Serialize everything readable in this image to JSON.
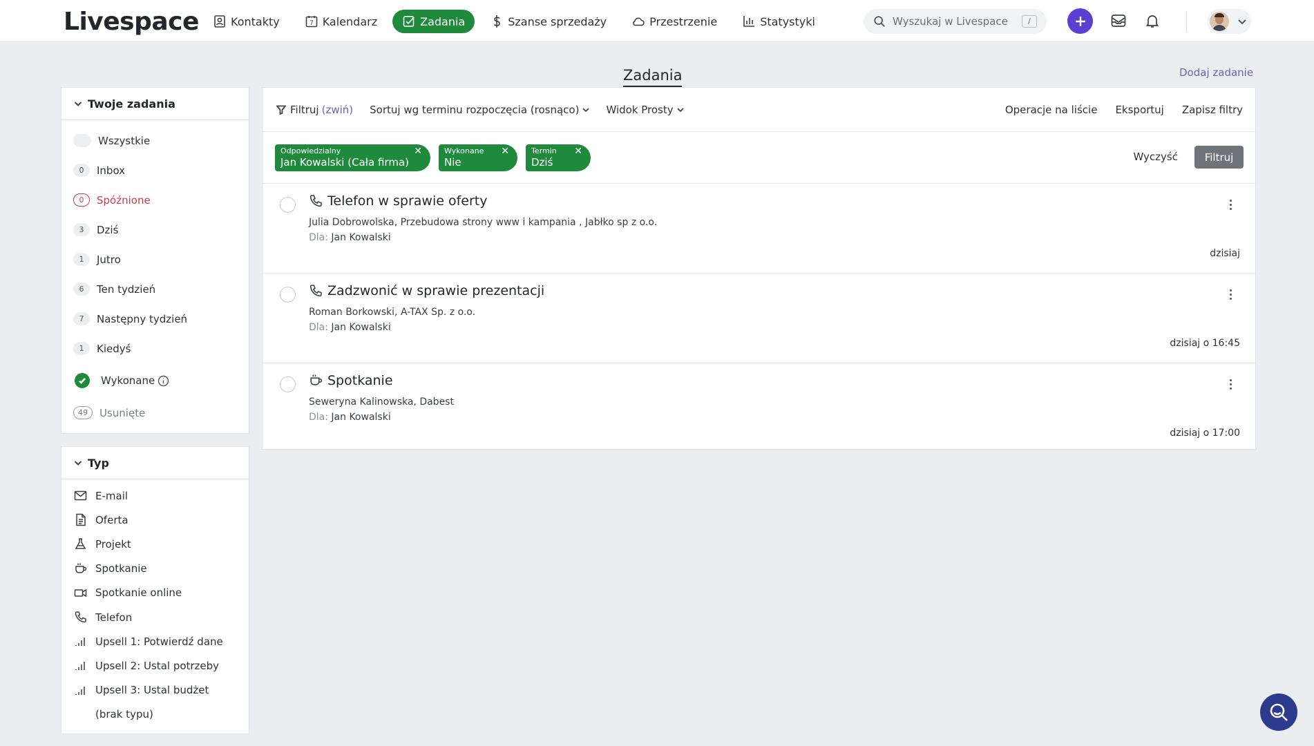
{
  "brand": {
    "logo": "Livespace",
    "accent": "#1f8a3b",
    "primary": "#5b3fd1"
  },
  "nav": [
    {
      "label": "Kontakty",
      "icon": "contact-card-icon"
    },
    {
      "label": "Kalendarz",
      "icon": "calendar-icon",
      "badge": "7"
    },
    {
      "label": "Zadania",
      "icon": "task-check-icon",
      "active": true
    },
    {
      "label": "Szanse sprzedaży",
      "icon": "dollar-icon"
    },
    {
      "label": "Przestrzenie",
      "icon": "cloud-icon"
    },
    {
      "label": "Statystyki",
      "icon": "bar-chart-icon"
    }
  ],
  "search": {
    "placeholder": "Wyszukaj w Livespace",
    "shortcut": "/"
  },
  "page": {
    "title": "Zadania",
    "add_task": "Dodaj zadanie"
  },
  "your_tasks": {
    "heading": "Twoje zadania",
    "items": [
      {
        "label": "Wszystkie",
        "count": ""
      },
      {
        "label": "Inbox",
        "count": "0"
      },
      {
        "label": "Spóźnione",
        "count": "0",
        "status": "late"
      },
      {
        "label": "Dziś",
        "count": "3"
      },
      {
        "label": "Jutro",
        "count": "1"
      },
      {
        "label": "Ten tydzień",
        "count": "6"
      },
      {
        "label": "Następny tydzień",
        "count": "7"
      },
      {
        "label": "Kiedyś",
        "count": "1"
      },
      {
        "label": "Wykonane",
        "count": ""
      },
      {
        "label": "Usunięte",
        "count": "49"
      }
    ]
  },
  "types": {
    "heading": "Typ",
    "items": [
      {
        "label": "E-mail",
        "icon": "envelope-icon"
      },
      {
        "label": "Oferta",
        "icon": "document-icon"
      },
      {
        "label": "Projekt",
        "icon": "flask-icon"
      },
      {
        "label": "Spotkanie",
        "icon": "coffee-cup-icon"
      },
      {
        "label": "Spotkanie online",
        "icon": "video-camera-icon"
      },
      {
        "label": "Telefon",
        "icon": "phone-icon"
      },
      {
        "label": "Upsell 1: Potwierdź dane",
        "icon": "signal-bars-icon"
      },
      {
        "label": "Upsell 2: Ustal potrzeby",
        "icon": "signal-bars-icon"
      },
      {
        "label": "Upsell 3: Ustal budżet",
        "icon": "signal-bars-icon"
      },
      {
        "label": "(brak typu)",
        "icon": ""
      }
    ]
  },
  "toolbar": {
    "filter": "Filtruj",
    "collapse": "(zwiń)",
    "sort": "Sortuj wg terminu rozpoczęcia (rosnąco)",
    "view": "Widok Prosty",
    "list_ops": "Operacje na liście",
    "export": "Eksportuj",
    "save_filters": "Zapisz filtry"
  },
  "chips": [
    {
      "key": "Odpowiedzialny",
      "value": "Jan Kowalski (Cała firma)"
    },
    {
      "key": "Wykonane",
      "value": "Nie"
    },
    {
      "key": "Termin",
      "value": "Dziś"
    }
  ],
  "chip_actions": {
    "clear": "Wyczyść",
    "apply": "Filtruj"
  },
  "tasks": [
    {
      "title": "Telefon w sprawie oferty",
      "icon": "phone-icon",
      "desc": "Julia Dobrowolska, Przebudowa strony www i kampania , Jabłko sp z o.o.",
      "for_label": "Dla:",
      "for": "Jan Kowalski",
      "when": "dzisiaj"
    },
    {
      "title": "Zadzwonić w sprawie prezentacji",
      "icon": "phone-icon",
      "desc": "Roman Borkowski, A-TAX Sp. z o.o.",
      "for_label": "Dla:",
      "for": "Jan Kowalski",
      "when": "dzisiaj o 16:45"
    },
    {
      "title": "Spotkanie",
      "icon": "coffee-cup-icon",
      "desc": "Seweryna Kalinowska, Dabest",
      "for_label": "Dla:",
      "for": "Jan Kowalski",
      "when": "dzisiaj o 17:00"
    }
  ]
}
